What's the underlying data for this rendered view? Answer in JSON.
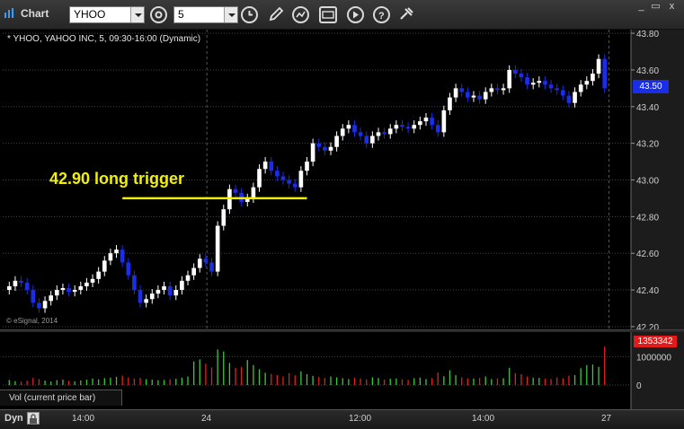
{
  "window": {
    "title": "Chart",
    "symbol": "YHOO",
    "interval": "5",
    "min_label": "_",
    "max_label": "▭",
    "close_label": "x"
  },
  "toolbar_icons": [
    "settings-cog-icon",
    "clock-icon",
    "pencil-icon",
    "refresh-icon",
    "compare-icon",
    "play-icon",
    "help-icon",
    "tools-icon"
  ],
  "legend": "* YHOO, YAHOO INC, 5, 09:30-16:00 (Dynamic)",
  "copyright": "© eSignal, 2014",
  "annotation": {
    "text": "42.90 long trigger",
    "price": 42.9,
    "color": "#f0f000"
  },
  "last_price": "43.50",
  "volume_last": "1353342",
  "volume_pane_label": "Vol (current price bar)",
  "footer": {
    "mode_label": "Dyn"
  },
  "colors": {
    "up": "#ffffff",
    "down": "#1a2ee8",
    "grid": "#444444",
    "vol_up": "#3cc83c",
    "vol_down": "#e02020",
    "background": "#000000"
  },
  "chart_data": {
    "type": "candlestick",
    "ylim": [
      42.18,
      43.82
    ],
    "price_ticks": [
      "43.80",
      "43.60",
      "43.40",
      "43.20",
      "43.00",
      "42.80",
      "42.60",
      "42.40",
      "42.20"
    ],
    "volume_ticks": [
      "1000000",
      "0"
    ],
    "volume_ylim": [
      0,
      1800000
    ],
    "time_ticks": [
      "14:00",
      "24",
      "12:00",
      "14:00",
      "27"
    ],
    "close": [
      42.42,
      42.45,
      42.44,
      42.4,
      42.33,
      42.3,
      42.34,
      42.37,
      42.4,
      42.41,
      42.39,
      42.4,
      42.42,
      42.44,
      42.46,
      42.5,
      42.56,
      42.6,
      42.62,
      42.55,
      42.48,
      42.4,
      42.33,
      42.35,
      42.38,
      42.4,
      42.42,
      42.37,
      42.4,
      42.45,
      42.48,
      42.52,
      42.57,
      42.55,
      42.5,
      42.75,
      42.84,
      42.95,
      42.93,
      42.88,
      42.9,
      42.96,
      43.06,
      43.1,
      43.05,
      43.02,
      43.0,
      42.98,
      42.96,
      43.05,
      43.1,
      43.2,
      43.18,
      43.16,
      43.18,
      43.24,
      43.28,
      43.3,
      43.26,
      43.24,
      43.2,
      43.24,
      43.26,
      43.25,
      43.28,
      43.3,
      43.29,
      43.28,
      43.3,
      43.32,
      43.34,
      43.3,
      43.26,
      43.38,
      43.45,
      43.5,
      43.48,
      43.45,
      43.46,
      43.44,
      43.48,
      43.5,
      43.49,
      43.5,
      43.6,
      43.58,
      43.56,
      43.52,
      43.53,
      43.54,
      43.52,
      43.5,
      43.49,
      43.46,
      43.42,
      43.48,
      43.52,
      43.54,
      43.58,
      43.66,
      43.5
    ],
    "open": [
      42.4,
      42.42,
      42.45,
      42.44,
      42.4,
      42.33,
      42.3,
      42.34,
      42.37,
      42.4,
      42.41,
      42.39,
      42.4,
      42.42,
      42.44,
      42.46,
      42.5,
      42.56,
      42.6,
      42.62,
      42.55,
      42.48,
      42.4,
      42.33,
      42.35,
      42.38,
      42.4,
      42.42,
      42.37,
      42.4,
      42.45,
      42.48,
      42.52,
      42.57,
      42.55,
      42.5,
      42.75,
      42.84,
      42.95,
      42.93,
      42.88,
      42.9,
      42.96,
      43.06,
      43.1,
      43.05,
      43.02,
      43.0,
      42.98,
      42.96,
      43.05,
      43.1,
      43.2,
      43.18,
      43.16,
      43.18,
      43.24,
      43.28,
      43.3,
      43.26,
      43.24,
      43.2,
      43.24,
      43.26,
      43.25,
      43.28,
      43.3,
      43.29,
      43.28,
      43.3,
      43.32,
      43.34,
      43.3,
      43.26,
      43.38,
      43.45,
      43.5,
      43.48,
      43.45,
      43.46,
      43.44,
      43.48,
      43.5,
      43.49,
      43.5,
      43.6,
      43.58,
      43.56,
      43.52,
      43.53,
      43.54,
      43.52,
      43.5,
      43.49,
      43.46,
      43.42,
      43.48,
      43.52,
      43.54,
      43.58,
      43.66
    ],
    "volume": [
      180000,
      140000,
      120000,
      150000,
      260000,
      210000,
      160000,
      120000,
      170000,
      190000,
      150000,
      130000,
      160000,
      190000,
      230000,
      200000,
      240000,
      260000,
      290000,
      330000,
      270000,
      230000,
      250000,
      210000,
      190000,
      170000,
      180000,
      200000,
      220000,
      260000,
      300000,
      830000,
      900000,
      750000,
      620000,
      1250000,
      1180000,
      780000,
      600000,
      640000,
      880000,
      700000,
      560000,
      430000,
      390000,
      350000,
      300000,
      420000,
      340000,
      480000,
      380000,
      320000,
      280000,
      250000,
      300000,
      270000,
      240000,
      210000,
      260000,
      230000,
      200000,
      270000,
      250000,
      190000,
      220000,
      230000,
      200000,
      180000,
      240000,
      260000,
      210000,
      250000,
      440000,
      310000,
      520000,
      350000,
      270000,
      240000,
      230000,
      250000,
      300000,
      210000,
      230000,
      240000,
      600000,
      420000,
      380000,
      300000,
      260000,
      250000,
      220000,
      210000,
      270000,
      240000,
      330000,
      350000,
      590000,
      700000,
      720000,
      640000,
      1353342
    ]
  }
}
